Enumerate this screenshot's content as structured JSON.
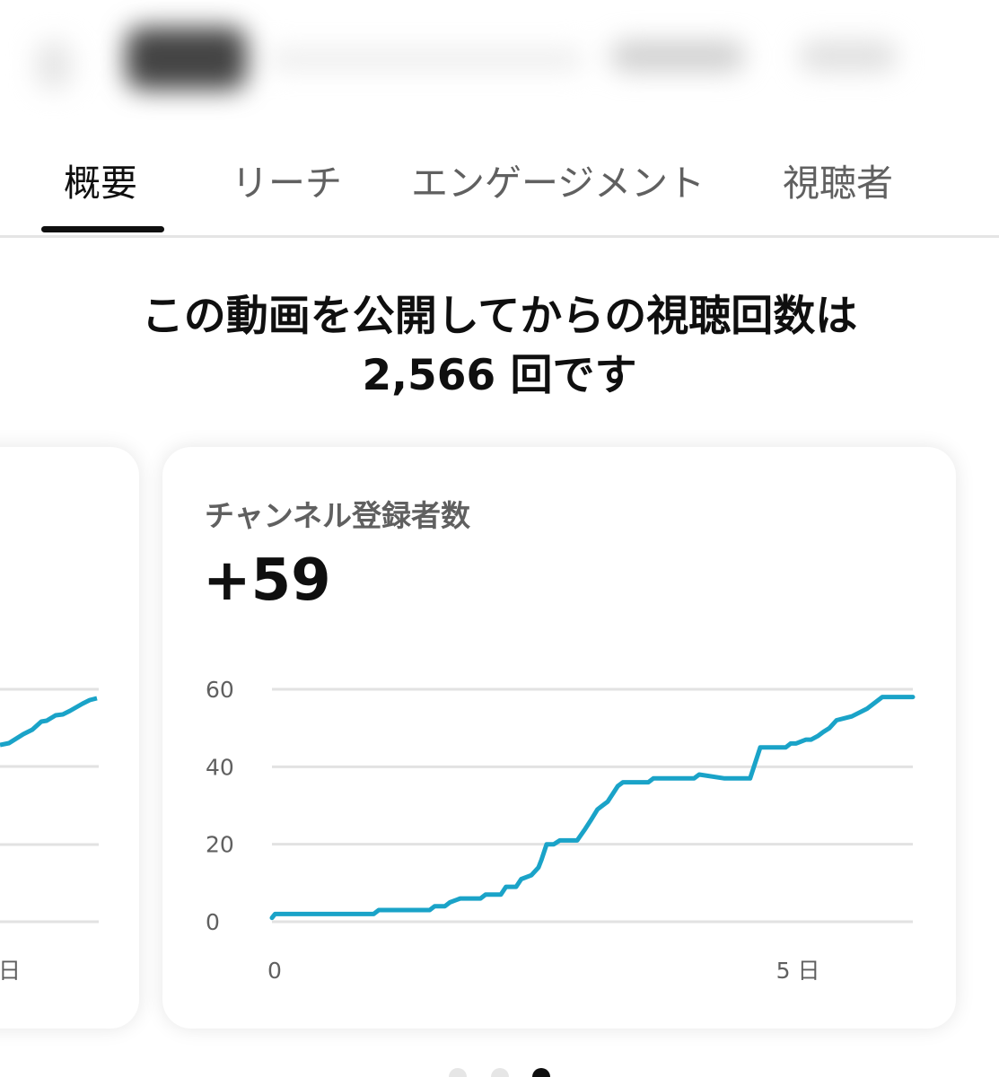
{
  "tabs": [
    {
      "label": "概要",
      "active": true
    },
    {
      "label": "リーチ",
      "active": false
    },
    {
      "label": "エンゲージメント",
      "active": false
    },
    {
      "label": "視聴者",
      "active": false
    }
  ],
  "headline": {
    "line1": "この動画を公開してからの視聴回数は",
    "line2": "2,566 回です"
  },
  "cards": {
    "previous_card": {
      "x_tick_partial": "日"
    },
    "subscribers": {
      "title": "チャンネル登録者数",
      "value": "+59"
    }
  },
  "colors": {
    "line": "#1aa3c8",
    "grid": "#e2e2e2",
    "active_tab": "#0f0f0f",
    "inactive_text": "#606060"
  },
  "pager": {
    "count": 3,
    "active_index": 2
  },
  "chart_data": {
    "type": "line",
    "title": "チャンネル登録者数",
    "xlabel": "",
    "ylabel": "",
    "ylim": [
      0,
      60
    ],
    "yticks": [
      "0",
      "20",
      "40",
      "60"
    ],
    "xticks": [
      {
        "value": 0,
        "label": "0"
      },
      {
        "value": 5,
        "label": "5 日"
      }
    ],
    "xlim": [
      0,
      6.3
    ],
    "grid": true,
    "series": [
      {
        "x": [
          0,
          0.03,
          1,
          1.05,
          1.55,
          1.6,
          1.7,
          1.75,
          1.85,
          1.9,
          2.05,
          2.1,
          2.25,
          2.3,
          2.4,
          2.45,
          2.55,
          2.62,
          2.65,
          2.7,
          2.77,
          2.83,
          3.0,
          3.08,
          3.13,
          3.2,
          3.25,
          3.3,
          3.35,
          3.4,
          3.45,
          3.55,
          3.7,
          3.75,
          3.9,
          4.15,
          4.2,
          4.45,
          4.55,
          4.7,
          4.8,
          5.0,
          5.05,
          5.1,
          5.15,
          5.25,
          5.3,
          5.37,
          5.42,
          5.48,
          5.55,
          5.7,
          5.85,
          5.9,
          6.0,
          6.3
        ],
        "values": [
          1,
          2,
          2,
          3,
          3,
          4,
          4,
          5,
          6,
          6,
          6,
          7,
          7,
          9,
          9,
          11,
          12,
          14,
          16,
          20,
          20,
          21,
          21,
          24,
          26,
          29,
          30,
          31,
          33,
          35,
          36,
          36,
          36,
          37,
          37,
          37,
          38,
          37,
          37,
          37,
          45,
          45,
          45,
          46,
          46,
          47,
          47,
          48,
          49,
          50,
          52,
          53,
          55,
          56,
          58,
          58
        ]
      }
    ]
  }
}
